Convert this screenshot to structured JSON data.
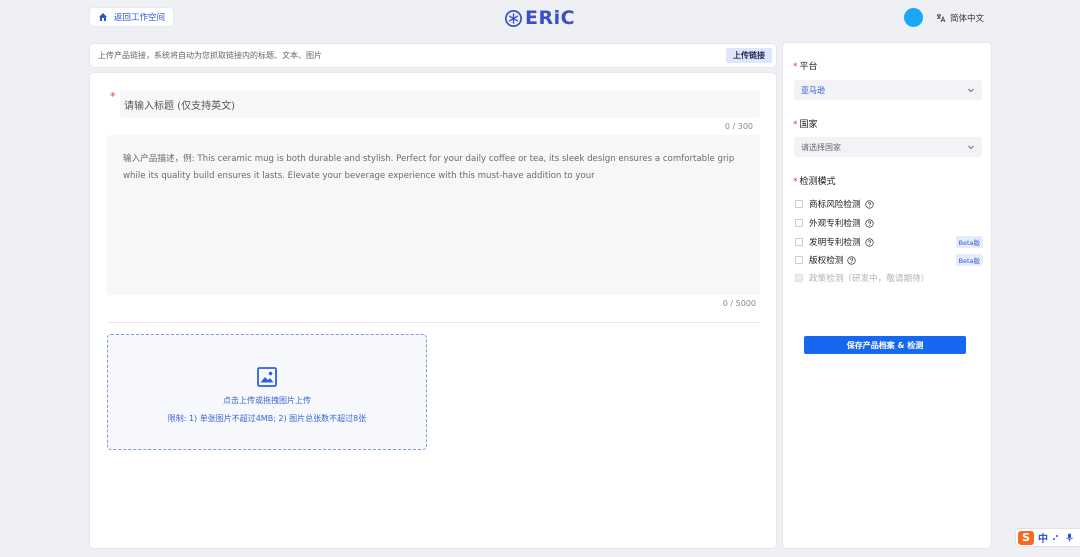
{
  "header": {
    "back_label": "返回工作空间",
    "logo_text": "ERiC",
    "language_label": "简体中文"
  },
  "linkbar": {
    "hint": "上传产品链接，系统将自动为您抓取链接内的标题、文本、图片",
    "button_label": "上传链接"
  },
  "main": {
    "title_required_mark": "*",
    "title_placeholder": "请输入标题 (仅支持英文)",
    "title_count": "0 / 300",
    "description_placeholder": "输入产品描述，例:   This ceramic mug is both durable and stylish. Perfect for your daily coffee or tea, its sleek design ensures a comfortable grip while its quality build ensures it lasts. Elevate your beverage experience with this must-have addition to your",
    "description_count": "0 / 5000",
    "upload": {
      "line1": "点击上传或拖拽图片上传",
      "line2": "限制: 1) 单张图片不超过4MB; 2) 图片总张数不超过8张"
    }
  },
  "side": {
    "platform": {
      "label": "平台",
      "value": "亚马逊"
    },
    "country": {
      "label": "国家",
      "placeholder": "请选择国家"
    },
    "mode": {
      "label": "检测模式",
      "options": [
        {
          "label": "商标风险检测",
          "beta": ""
        },
        {
          "label": "外观专利检测",
          "beta": ""
        },
        {
          "label": "发明专利检测",
          "beta": "Beta版"
        },
        {
          "label": "版权检测",
          "beta": "Beta版"
        },
        {
          "label": "政策检测（研发中，敬请期待）",
          "beta": ""
        }
      ]
    },
    "save_label": "保存产品档案 & 检测"
  },
  "ime": {
    "zh": "中"
  },
  "colors": {
    "accent": "#1668f0",
    "brand": "#3b4fc8",
    "required": "#e3392f",
    "avatar": "#1aa7f5"
  }
}
